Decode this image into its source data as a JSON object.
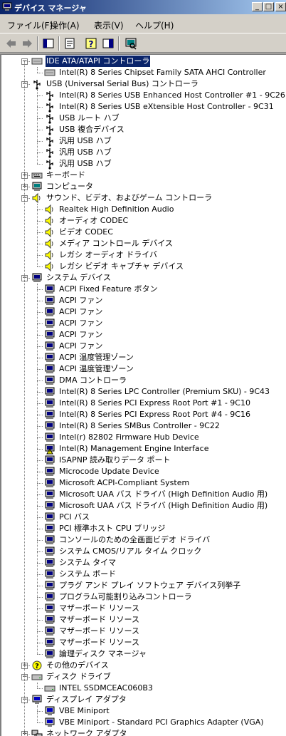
{
  "window": {
    "title": "デバイス マネージャ",
    "btn_min": "_",
    "btn_max": "□",
    "btn_close": "×"
  },
  "menu": [
    "ファイル(F)",
    "操作(A)",
    "表示(V)",
    "ヘルプ(H)"
  ],
  "toolbar": [
    "back-icon",
    "forward-icon",
    "show-hide-tree-icon",
    "properties-icon",
    "help-icon",
    "view-icon",
    "scan-hardware-icon"
  ],
  "tree": [
    {
      "id": "ide",
      "label": "IDE ATA/ATAPI コントローラ",
      "icon": "ide-icon",
      "expanded": true,
      "selected": true,
      "children": [
        {
          "label": "Intel(R) 8 Series Chipset Family SATA AHCI Controller",
          "icon": "ide-icon"
        }
      ]
    },
    {
      "id": "usb",
      "label": "USB (Universal Serial Bus) コントローラ",
      "icon": "usb-icon",
      "expanded": true,
      "children": [
        {
          "label": "Intel(R) 8 Series USB Enhanced Host Controller #1 - 9C26",
          "icon": "usb-icon"
        },
        {
          "label": "Intel(R) 8 Series USB eXtensible Host Controller - 9C31",
          "icon": "usb-icon"
        },
        {
          "label": "USB ルート ハブ",
          "icon": "usb-icon"
        },
        {
          "label": "USB 複合デバイス",
          "icon": "usb-icon"
        },
        {
          "label": "汎用 USB ハブ",
          "icon": "usb-icon"
        },
        {
          "label": "汎用 USB ハブ",
          "icon": "usb-icon"
        },
        {
          "label": "汎用 USB ハブ",
          "icon": "usb-icon"
        }
      ]
    },
    {
      "id": "keyboard",
      "label": "キーボード",
      "icon": "keyboard-icon",
      "expanded": false,
      "children": []
    },
    {
      "id": "computer",
      "label": "コンピュータ",
      "icon": "computer-icon",
      "expanded": false,
      "children": []
    },
    {
      "id": "sound",
      "label": "サウンド、ビデオ、およびゲーム コントローラ",
      "icon": "speaker-icon",
      "expanded": true,
      "children": [
        {
          "label": "Realtek High Definition Audio",
          "icon": "speaker-icon"
        },
        {
          "label": "オーディオ CODEC",
          "icon": "speaker-icon"
        },
        {
          "label": "ビデオ CODEC",
          "icon": "speaker-icon"
        },
        {
          "label": "メディア コントロール デバイス",
          "icon": "speaker-icon"
        },
        {
          "label": "レガシ オーディオ ドライバ",
          "icon": "speaker-icon"
        },
        {
          "label": "レガシ ビデオ キャプチャ デバイス",
          "icon": "speaker-icon"
        }
      ]
    },
    {
      "id": "system",
      "label": "システム デバイス",
      "icon": "system-device-icon",
      "expanded": true,
      "children": [
        {
          "label": "ACPI Fixed Feature ボタン",
          "icon": "system-device-icon"
        },
        {
          "label": "ACPI ファン",
          "icon": "system-device-icon"
        },
        {
          "label": "ACPI ファン",
          "icon": "system-device-icon"
        },
        {
          "label": "ACPI ファン",
          "icon": "system-device-icon"
        },
        {
          "label": "ACPI ファン",
          "icon": "system-device-icon"
        },
        {
          "label": "ACPI ファン",
          "icon": "system-device-icon"
        },
        {
          "label": "ACPI 温度管理ゾーン",
          "icon": "system-device-icon"
        },
        {
          "label": "ACPI 温度管理ゾーン",
          "icon": "system-device-icon"
        },
        {
          "label": "DMA コントローラ",
          "icon": "system-device-icon"
        },
        {
          "label": "Intel(R) 8 Series LPC Controller (Premium SKU) - 9C43",
          "icon": "system-device-icon"
        },
        {
          "label": "Intel(R) 8 Series PCI Express Root Port #1 - 9C10",
          "icon": "system-device-icon"
        },
        {
          "label": "Intel(R) 8 Series PCI Express Root Port #4 - 9C16",
          "icon": "system-device-icon"
        },
        {
          "label": "Intel(R) 8 Series SMBus Controller - 9C22",
          "icon": "system-device-icon"
        },
        {
          "label": "Intel(r) 82802 Firmware Hub Device",
          "icon": "system-device-icon"
        },
        {
          "label": "Intel(R) Management Engine Interface",
          "icon": "warning-device-icon"
        },
        {
          "label": "ISAPNP 読み取りデータ ポート",
          "icon": "system-device-icon"
        },
        {
          "label": "Microcode Update Device",
          "icon": "system-device-icon"
        },
        {
          "label": "Microsoft ACPI-Compliant System",
          "icon": "system-device-icon"
        },
        {
          "label": "Microsoft UAA バス ドライバ (High Definition Audio 用)",
          "icon": "system-device-icon"
        },
        {
          "label": "Microsoft UAA バス ドライバ (High Definition Audio 用)",
          "icon": "system-device-icon"
        },
        {
          "label": "PCI バス",
          "icon": "system-device-icon"
        },
        {
          "label": "PCI 標準ホスト CPU ブリッジ",
          "icon": "system-device-icon"
        },
        {
          "label": "コンソールのための全画面ビデオ ドライバ",
          "icon": "system-device-icon"
        },
        {
          "label": "システム CMOS/リアル タイム クロック",
          "icon": "system-device-icon"
        },
        {
          "label": "システム タイマ",
          "icon": "system-device-icon"
        },
        {
          "label": "システム ボード",
          "icon": "system-device-icon"
        },
        {
          "label": "プラグ アンド プレイ ソフトウェア デバイス列挙子",
          "icon": "system-device-icon"
        },
        {
          "label": "プログラム可能割り込みコントローラ",
          "icon": "system-device-icon"
        },
        {
          "label": "マザーボード リソース",
          "icon": "system-device-icon"
        },
        {
          "label": "マザーボード リソース",
          "icon": "system-device-icon"
        },
        {
          "label": "マザーボード リソース",
          "icon": "system-device-icon"
        },
        {
          "label": "マザーボード リソース",
          "icon": "system-device-icon"
        },
        {
          "label": "論理ディスク マネージャ",
          "icon": "system-device-icon"
        }
      ]
    },
    {
      "id": "other",
      "label": "その他のデバイス",
      "icon": "unknown-device-icon",
      "expanded": false,
      "children": []
    },
    {
      "id": "disk",
      "label": "ディスク ドライブ",
      "icon": "disk-drive-icon",
      "expanded": true,
      "children": [
        {
          "label": "INTEL SSDMCEAC060B3",
          "icon": "disk-drive-icon"
        }
      ]
    },
    {
      "id": "display",
      "label": "ディスプレイ アダプタ",
      "icon": "display-icon",
      "expanded": true,
      "children": [
        {
          "label": "VBE Miniport",
          "icon": "display-icon"
        },
        {
          "label": "VBE Miniport - Standard PCI Graphics Adapter (VGA)",
          "icon": "display-icon"
        }
      ]
    },
    {
      "id": "network",
      "label": "ネットワーク アダプタ",
      "icon": "network-icon",
      "expanded": false,
      "children": []
    }
  ]
}
